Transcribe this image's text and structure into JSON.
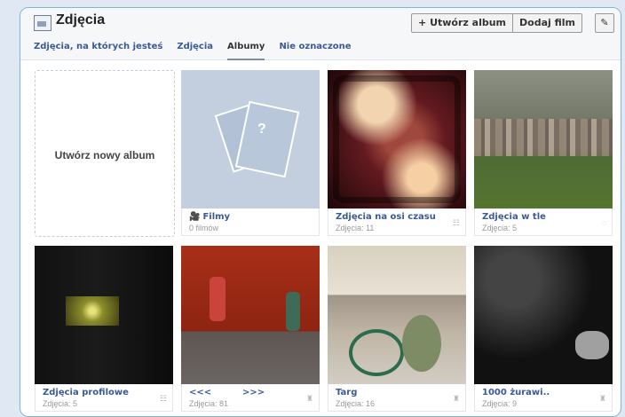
{
  "header": {
    "title": "Zdjęcia",
    "buttons": {
      "create_album": "+ Utwórz album",
      "add_film": "Dodaj film",
      "edit_icon": "pencil-icon"
    }
  },
  "tabs": [
    {
      "label": "Zdjęcia, na których jesteś"
    },
    {
      "label": "Zdjęcia"
    },
    {
      "label": "Albumy"
    },
    {
      "label": "Nie oznaczone"
    }
  ],
  "create_album": {
    "label": "Utwórz nowy album"
  },
  "albums": [
    {
      "name": "Filmy",
      "count": "0 filmów",
      "icon": "film-icon",
      "privacy": ""
    },
    {
      "name": "Zdjęcia na osi czasu",
      "count": "Zdjęcia: 11",
      "privacy": "☷"
    },
    {
      "name": "Zdjęcia w tle",
      "count": "Zdjęcia: 5",
      "privacy": "◌"
    },
    {
      "name": "Zdjęcia profilowe",
      "count": "Zdjęcia: 5",
      "privacy": "☷"
    },
    {
      "name": "<<<          >>>",
      "count": "Zdjęcia: 81",
      "privacy": "♜"
    },
    {
      "name": "Targ",
      "count": "Zdjęcia: 16",
      "privacy": "♜"
    },
    {
      "name": "1000 żurawi..",
      "count": "Zdjęcia: 9",
      "privacy": "♜"
    }
  ],
  "colors": {
    "link": "#3b5998",
    "frame": "#7fb6d8",
    "background": "#dfe8f3"
  }
}
